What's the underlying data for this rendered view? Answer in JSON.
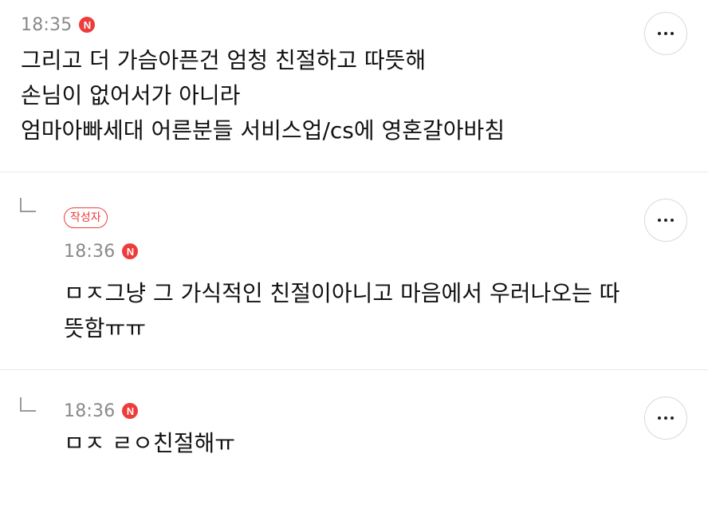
{
  "comments": [
    {
      "time": "18:35",
      "badge": "N",
      "lines": [
        "그리고 더 가슴아픈건 엄청 친절하고 따뜻해",
        "손님이 없어서가 아니라",
        "엄마아빠세대 어른분들 서비스업/cs에 영혼갈아바침"
      ]
    },
    {
      "author_label": "작성자",
      "time": "18:36",
      "badge": "N",
      "lines": [
        "ㅁㅈ그냥 그 가식적인 친절이아니고 마음에서 우러나오는 따",
        "뜻함ㅠㅠ"
      ]
    },
    {
      "time": "18:36",
      "badge": "N",
      "lines": [
        "ㅁㅈ ㄹㅇ친절해ㅠ"
      ]
    }
  ],
  "icons": {
    "more": "more-horizontal-icon",
    "reply": "reply-arrow-icon",
    "new": "new-badge-icon"
  },
  "colors": {
    "accent": "#ee3b3b",
    "meta_text": "#8a8a8a",
    "divider": "#e9e9e9"
  }
}
